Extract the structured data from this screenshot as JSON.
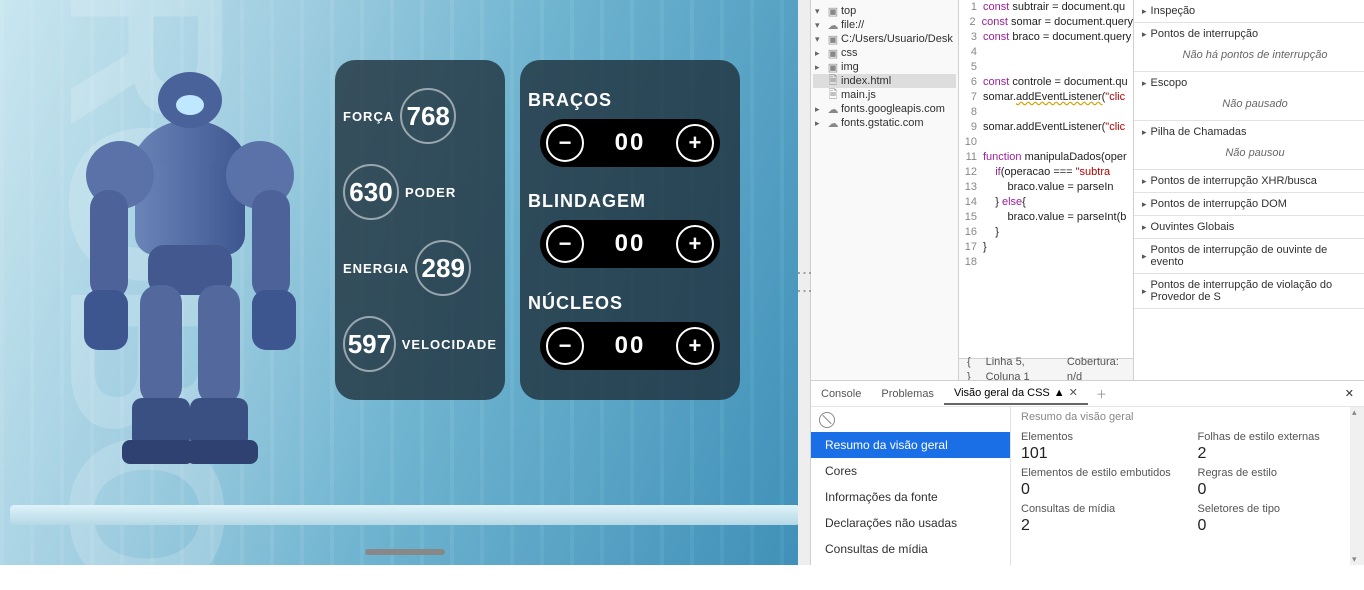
{
  "stats": [
    {
      "label": "FORÇA",
      "value": "768",
      "labelFirst": true
    },
    {
      "label": "PODER",
      "value": "630",
      "labelFirst": false
    },
    {
      "label": "ENERGIA",
      "value": "289",
      "labelFirst": true
    },
    {
      "label": "VELOCIDADE",
      "value": "597",
      "labelFirst": false
    }
  ],
  "controls": [
    {
      "title": "BRAÇOS",
      "value": "00"
    },
    {
      "title": "BLINDAGEM",
      "value": "00"
    },
    {
      "title": "NÚCLEOS",
      "value": "00"
    }
  ],
  "tree": [
    {
      "indent": 0,
      "tw": "▾",
      "icon": "folder",
      "label": "top"
    },
    {
      "indent": 1,
      "tw": "▾",
      "icon": "cloud",
      "label": "file://"
    },
    {
      "indent": 2,
      "tw": "▾",
      "icon": "folder",
      "label": "C:/Users/Usuario/Desk"
    },
    {
      "indent": 3,
      "tw": "▸",
      "icon": "folder",
      "label": "css"
    },
    {
      "indent": 3,
      "tw": "▸",
      "icon": "folder",
      "label": "img"
    },
    {
      "indent": 3,
      "tw": "",
      "icon": "file",
      "label": "index.html",
      "sel": true
    },
    {
      "indent": 3,
      "tw": "",
      "icon": "file",
      "label": "main.js"
    },
    {
      "indent": 1,
      "tw": "▸",
      "icon": "cloud",
      "label": "fonts.googleapis.com"
    },
    {
      "indent": 1,
      "tw": "▸",
      "icon": "cloud",
      "label": "fonts.gstatic.com"
    }
  ],
  "code": [
    {
      "n": 1,
      "h": "<span class='kw'>const</span> subtrair = document.qu"
    },
    {
      "n": 2,
      "h": "<span class='kw'>const</span> somar = document.query"
    },
    {
      "n": 3,
      "h": "<span class='kw'>const</span> braco = document.query"
    },
    {
      "n": 4,
      "h": ""
    },
    {
      "n": 5,
      "h": ""
    },
    {
      "n": 6,
      "h": "<span class='kw'>const</span> controle = document.qu"
    },
    {
      "n": 7,
      "h": "somar.<span class='ul'>addEventListener(</span><span class='str'>\"clic</span>"
    },
    {
      "n": 8,
      "h": ""
    },
    {
      "n": 9,
      "h": "somar.addEventListener(<span class='str'>\"clic</span>"
    },
    {
      "n": 10,
      "h": ""
    },
    {
      "n": 11,
      "h": "<span class='kw'>function</span> manipulaDados(oper"
    },
    {
      "n": 12,
      "h": "    <span class='kw'>if</span>(operacao === <span class='str'>\"subtra</span>"
    },
    {
      "n": 13,
      "h": "        braco.value = parseIn"
    },
    {
      "n": 14,
      "h": "    } <span class='kw'>else</span>{"
    },
    {
      "n": 15,
      "h": "        braco.value = parseInt(b"
    },
    {
      "n": 16,
      "h": "    }"
    },
    {
      "n": 17,
      "h": "}"
    },
    {
      "n": 18,
      "h": ""
    }
  ],
  "codefoot": {
    "braces": "{ }",
    "pos": "Linha 5, Coluna 1",
    "cov": "Cobertura: n/d"
  },
  "acc": [
    {
      "title": "Inspeção"
    },
    {
      "title": "Pontos de interrupção",
      "body": "Não há pontos de interrupção"
    },
    {
      "title": "Escopo",
      "body": "Não pausado"
    },
    {
      "title": "Pilha de Chamadas",
      "body": "Não pausou"
    },
    {
      "title": "Pontos de interrupção XHR/busca"
    },
    {
      "title": "Pontos de interrupção DOM"
    },
    {
      "title": "Ouvintes Globais"
    },
    {
      "title": "Pontos de interrupção de ouvinte de evento"
    },
    {
      "title": "Pontos de interrupção de violação do Provedor de S"
    }
  ],
  "bottabs": {
    "console": "Console",
    "problemas": "Problemas",
    "css": "Visão geral da CSS"
  },
  "cssnav": [
    "Resumo da visão geral",
    "Cores",
    "Informações da fonte",
    "Declarações não usadas",
    "Consultas de mídia"
  ],
  "csshead": "Resumo da visão geral",
  "csscards": [
    {
      "lbl": "Elementos",
      "num": "101"
    },
    {
      "lbl": "Folhas de estilo externas",
      "num": "2"
    },
    {
      "lbl": "Elementos de estilo embutidos",
      "num": "0"
    },
    {
      "lbl": "Regras de estilo",
      "num": "0"
    },
    {
      "lbl": "Consultas de mídia",
      "num": "2"
    },
    {
      "lbl": "Seletores de tipo",
      "num": "0"
    }
  ]
}
